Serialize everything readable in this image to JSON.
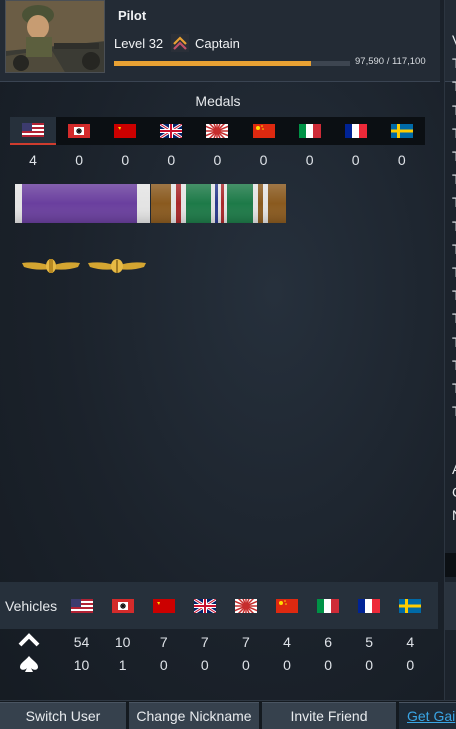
{
  "profile": {
    "name": "Pilot",
    "level": "Level 32",
    "rank": "Captain",
    "xp_text": "97,590 / 117,100",
    "xp_progress": 0.8334
  },
  "medals": {
    "title": "Medals",
    "selected_nation": "usa",
    "nations": [
      "usa",
      "germany",
      "ussr",
      "britain",
      "japan",
      "china",
      "italy",
      "france",
      "sweden"
    ],
    "counts": [
      "4",
      "0",
      "0",
      "0",
      "0",
      "0",
      "0",
      "0",
      "0"
    ]
  },
  "vehicles": {
    "label": "Vehicles",
    "nations": [
      "usa",
      "germany",
      "ussr",
      "britain",
      "japan",
      "china",
      "italy",
      "france",
      "sweden"
    ],
    "owned": [
      "54",
      "10",
      "7",
      "7",
      "7",
      "4",
      "6",
      "5",
      "4"
    ],
    "elite": [
      "10",
      "1",
      "0",
      "0",
      "0",
      "0",
      "0",
      "0",
      "0"
    ]
  },
  "buttons": {
    "switch_user": "Switch User",
    "change_nickname": "Change Nickname",
    "invite_friend": "Invite Friend",
    "get_gaijin": "Get Gai"
  },
  "right_column": {
    "letters": [
      "V",
      "T",
      "T",
      "T",
      "T",
      "T",
      "T",
      "T",
      "T",
      "T",
      "T",
      "T",
      "T",
      "T",
      "T",
      "T",
      "T",
      "A",
      "C",
      "N"
    ]
  },
  "colors": {
    "accent_orange": "#e8a133",
    "link_blue": "#3aa6e6",
    "selected_underline": "#cf3c2e"
  }
}
